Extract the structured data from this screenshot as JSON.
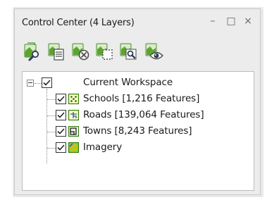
{
  "window": {
    "title": "Control Center (4 Layers)",
    "minimize_glyph": "–",
    "maximize_glyph": "□",
    "close_glyph": "×"
  },
  "toolbar": {
    "tools": [
      {
        "icon": "add-layer-search-icon"
      },
      {
        "icon": "layer-properties-icon"
      },
      {
        "icon": "remove-layer-icon"
      },
      {
        "icon": "layer-extent-icon"
      },
      {
        "icon": "zoom-to-layer-icon"
      },
      {
        "icon": "view-layer-icon"
      }
    ]
  },
  "tree": {
    "root": {
      "label": "Current Workspace",
      "checked": true,
      "expanded": true
    },
    "layers": [
      {
        "label": "Schools [1,216 Features]",
        "checked": true,
        "icon": "point-layer-icon",
        "color": "#2e7d00"
      },
      {
        "label": "Roads [139,064 Features]",
        "checked": true,
        "icon": "line-layer-icon",
        "color": "#2e7d00"
      },
      {
        "label": "Towns [8,243 Features]",
        "checked": true,
        "icon": "area-layer-icon",
        "color": "#2e7d00"
      },
      {
        "label": "Imagery",
        "checked": true,
        "icon": "raster-layer-icon",
        "color": "#2e7d00"
      }
    ]
  },
  "colors": {
    "accent_green": "#3c8a1e",
    "panel_bg": "#ececec"
  }
}
